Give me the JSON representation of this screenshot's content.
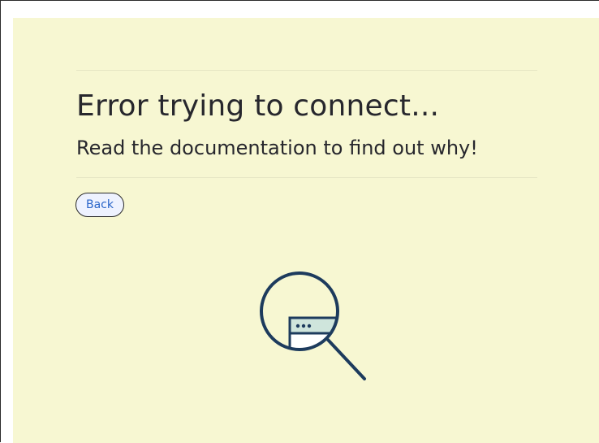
{
  "page": {
    "heading": "Error trying to connect...",
    "subheading": "Read the documentation to find out why!",
    "back_label": "Back"
  },
  "illustration": {
    "icon": "magnifier-browser-window-icon",
    "colors": {
      "outline": "#1d3b5d",
      "window_header": "#cfe5dc",
      "lens_fill": "#f7f7d2"
    }
  },
  "colors": {
    "background": "#f7f7d2",
    "text": "#27272d",
    "link": "#2b66c9",
    "rule": "#e6e6c4"
  }
}
